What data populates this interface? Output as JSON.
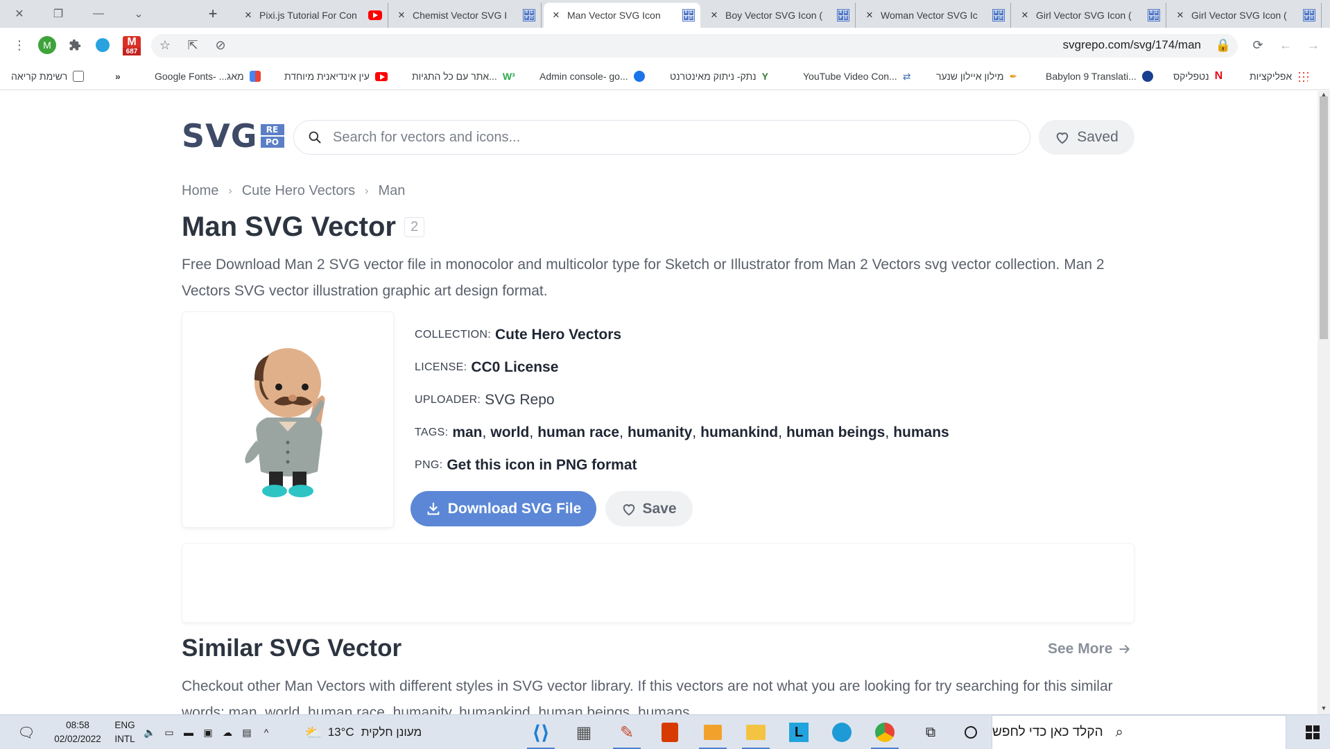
{
  "browser": {
    "tabs": [
      {
        "label": "Pixi.js Tutorial For Con",
        "favicon": "youtube-icon"
      },
      {
        "label": "Chemist Vector SVG I",
        "favicon": "svgrepo-icon"
      },
      {
        "label": "Man Vector SVG Icon",
        "favicon": "svgrepo-icon",
        "active": true
      },
      {
        "label": "Boy Vector SVG Icon (",
        "favicon": "svgrepo-icon"
      },
      {
        "label": "Woman Vector SVG Ic",
        "favicon": "svgrepo-icon"
      },
      {
        "label": "Girl Vector SVG Icon (",
        "favicon": "svgrepo-icon"
      },
      {
        "label": "Girl Vector SVG Icon (",
        "favicon": "svgrepo-icon"
      }
    ],
    "url": "svgrepo.com/svg/174/man",
    "gmail_badge": "687",
    "profile_letter": "M",
    "bookmarks": [
      {
        "label": "אפליקציות"
      },
      {
        "label": "נטפליקס"
      },
      {
        "label": "Babylon 9 Translati..."
      },
      {
        "label": "מילון איילון שנער"
      },
      {
        "label": "YouTube Video Con..."
      },
      {
        "label": "נתק- ניתוק מאינטרנט"
      },
      {
        "label": "Admin console- go..."
      },
      {
        "label": "אתר עם כל התגיות..."
      },
      {
        "label": "עין אינדיאנית מיוחדת"
      },
      {
        "label": "Google Fonts- ...מאג"
      },
      {
        "label": "»"
      },
      {
        "label": "רשימת קריאה"
      }
    ]
  },
  "site": {
    "logo_text": "SVG",
    "logo_repo": [
      "RE",
      "PO"
    ],
    "search_placeholder": "Search for vectors and icons...",
    "saved_label": "Saved"
  },
  "breadcrumb": [
    "Home",
    "Cute Hero Vectors",
    "Man"
  ],
  "title": "Man SVG Vector",
  "title_badge": "2",
  "description": "Free Download Man 2 SVG vector file in monocolor and multicolor type for Sketch or Illustrator from Man 2 Vectors svg vector collection. Man 2 Vectors SVG vector illustration graphic art design format.",
  "meta": {
    "collection_key": "COLLECTION:",
    "collection": "Cute Hero Vectors",
    "license_key": "LICENSE:",
    "license": "CC0 License",
    "uploader_key": "UPLOADER:",
    "uploader": "SVG Repo",
    "tags_key": "TAGS:",
    "tags": [
      "man",
      "world",
      "human race",
      "humanity",
      "humankind",
      "human beings",
      "humans"
    ],
    "png_key": "PNG:",
    "png": "Get this icon in PNG format"
  },
  "buttons": {
    "download": "Download SVG File",
    "save": "Save"
  },
  "similar": {
    "heading": "Similar SVG Vector",
    "see_more": "See More",
    "description": "Checkout other Man Vectors with different styles in SVG vector library. If this vectors are not what you are looking for try searching for this similar words: man, world, human race, humanity, humankind, human beings, humans"
  },
  "taskbar": {
    "time": "08:58",
    "date": "02/02/2022",
    "lang1": "ENG",
    "lang2": "INTL",
    "weather_temp": "13°C",
    "weather_desc": "מעונן חלקית",
    "search_placeholder": "הקלד כאן כדי לחפש"
  },
  "colors": {
    "accent": "#5b87d6",
    "logo": "#3e4a66",
    "repo": "#5b7fc7"
  }
}
